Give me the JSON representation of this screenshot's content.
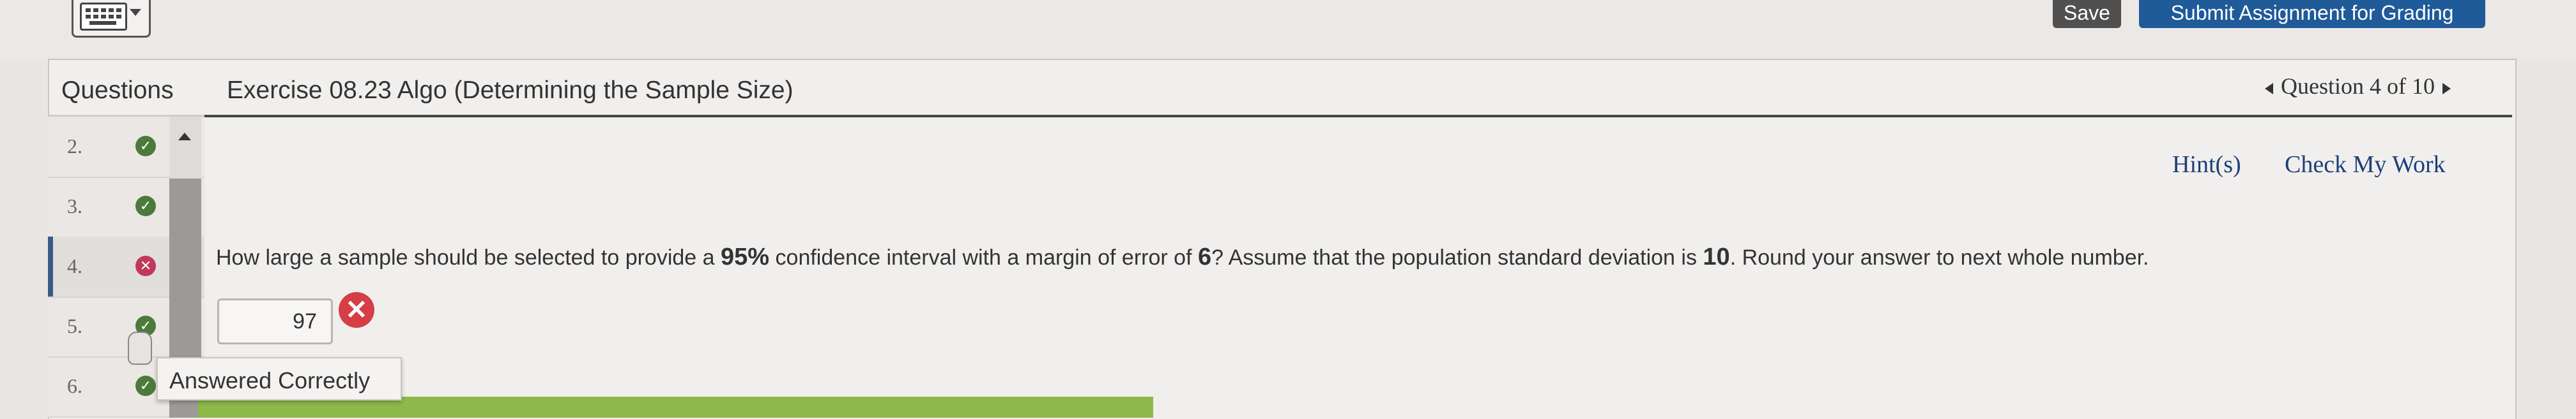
{
  "toolbar": {
    "save_label": "Save",
    "submit_label": "Submit Assignment for Grading",
    "keyboard_icon": "keyboard-icon"
  },
  "header": {
    "questions_label": "Questions",
    "exercise_title": "Exercise 08.23 Algo (Determining the Sample Size)",
    "question_nav": "Question 4 of 10"
  },
  "sidebar": {
    "items": [
      {
        "number": "2.",
        "status": "correct"
      },
      {
        "number": "3.",
        "status": "correct"
      },
      {
        "number": "4.",
        "status": "incorrect"
      },
      {
        "number": "5.",
        "status": "correct"
      },
      {
        "number": "6.",
        "status": "correct"
      }
    ]
  },
  "content": {
    "hint_label": "Hint(s)",
    "check_label": "Check My Work",
    "question_part1": "How large a sample should be selected to provide a ",
    "question_conf": "95%",
    "question_part2": " confidence interval with a margin of error of ",
    "question_moe": "6",
    "question_part3": "? Assume that the population standard deviation is ",
    "question_sd": "10",
    "question_part4": ". Round your answer to next whole number.",
    "answer_value": "97"
  },
  "tooltip": {
    "text": "Answered Correctly"
  },
  "colors": {
    "submit_button": "#1f5a99",
    "save_button": "#505050",
    "correct": "#4b7a3b",
    "incorrect": "#c0395a",
    "link": "#1d3f7a",
    "progress_green": "#8db94a"
  }
}
